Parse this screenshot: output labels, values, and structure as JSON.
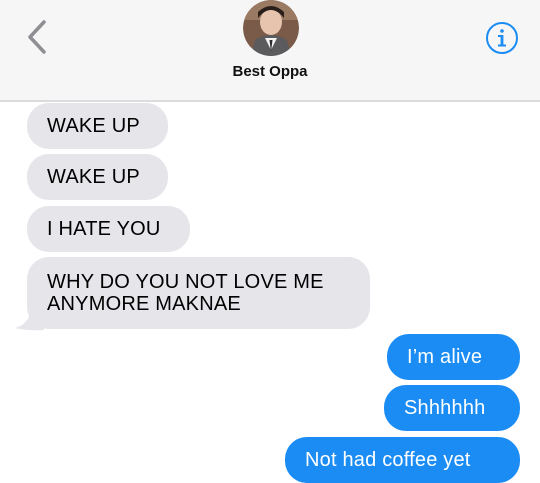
{
  "header": {
    "contact_name": "Best Oppa",
    "back_icon": "chevron-left-icon",
    "info_icon": "info-icon",
    "accent_color": "#1a8cf4"
  },
  "messages": {
    "incoming": [
      "WAKE UP",
      "WAKE UP",
      "I HATE YOU",
      "WHY DO YOU NOT LOVE ME ANYMORE MAKNAE"
    ],
    "outgoing": [
      "I’m alive",
      "Shhhhhh",
      "Not had coffee yet"
    ]
  },
  "colors": {
    "incoming_bubble": "#e5e5ea",
    "outgoing_bubble": "#1a8cf4",
    "header_bg": "#f6f6f6"
  }
}
